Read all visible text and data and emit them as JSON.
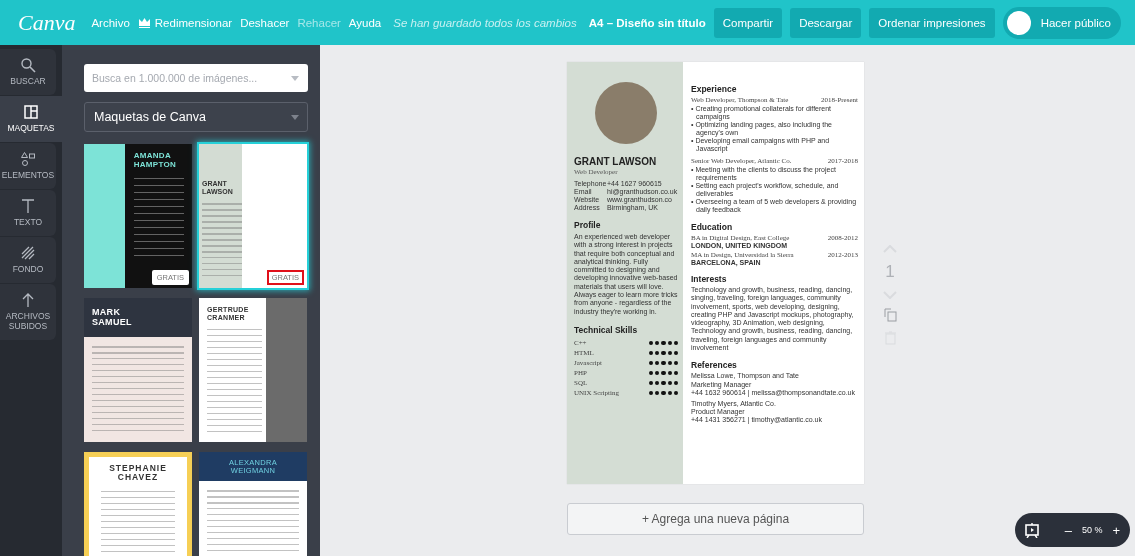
{
  "topbar": {
    "logo": "Canva",
    "menu": [
      {
        "label": "Archivo",
        "disabled": false
      },
      {
        "label": "Redimensionar",
        "disabled": false,
        "kind": "crown"
      },
      {
        "label": "Deshacer",
        "disabled": false
      },
      {
        "label": "Rehacer",
        "disabled": true
      },
      {
        "label": "Ayuda",
        "disabled": false
      }
    ],
    "save_status": "Se han guardado todos los cambios",
    "document_title": "A4 – Diseño sin título",
    "buttons": [
      "Compartir",
      "Descargar",
      "Ordenar impresiones"
    ],
    "public_toggle": {
      "label": "Hacer público",
      "on": false
    }
  },
  "sidebar": {
    "items": [
      {
        "label": "BUSCAR",
        "selected": false
      },
      {
        "label": "MAQUETAS",
        "selected": true
      },
      {
        "label": "ELEMENTOS",
        "selected": false
      },
      {
        "label": "TEXTO",
        "selected": false
      },
      {
        "label": "FONDO",
        "selected": false
      },
      {
        "label": "ARCHIVOS SUBIDOS",
        "selected": false
      }
    ]
  },
  "panel": {
    "search": {
      "placeholder": "Busca en 1.000.000 de imágenes..."
    },
    "dropdown": {
      "value": "Maquetas de Canva"
    },
    "templates": [
      {
        "kind": "teal-pattern",
        "title": "AMANDA HAMPTON",
        "badge": {
          "text": "GRATIS",
          "highlighted": false
        },
        "selected": false
      },
      {
        "kind": "photo-sidebar",
        "title": "GRANT LAWSON",
        "badge": {
          "text": "GRATIS",
          "highlighted": true
        },
        "selected": true
      },
      {
        "kind": "dark-header",
        "title": "MARK SAMUEL",
        "selected": false
      },
      {
        "kind": "photo-right",
        "title": "GERTRUDE CRANMER",
        "selected": false
      },
      {
        "kind": "yellow-frame",
        "title": "STEPHANIE CHAVEZ",
        "selected": false
      },
      {
        "kind": "navy-header",
        "title": "ALEXANDRA WEIGMANN",
        "selected": false
      }
    ]
  },
  "document": {
    "left": {
      "name": "GRANT LAWSON",
      "role": "Web Developer",
      "contacts": [
        {
          "label": "Telephone",
          "value": "+44 1627 960615"
        },
        {
          "label": "Email",
          "value": "hi@granthudson.co.uk"
        },
        {
          "label": "Website",
          "value": "www.granthudson.co"
        },
        {
          "label": "Address",
          "value": "Birmingham, UK"
        }
      ],
      "profile_heading": "Profile",
      "profile": "An experienced web developer with a strong interest in projects that require both conceptual and analytical thinking. Fully committed to designing and developing innovative web-based materials that users will love. Always eager to learn more tricks from anyone - regardless of the industry they're working in.",
      "skills_heading": "Technical Skills",
      "skills": [
        {
          "name": "C++",
          "stars": 5
        },
        {
          "name": "HTML",
          "stars": 5
        },
        {
          "name": "Javascript",
          "stars": 5
        },
        {
          "name": "PHP",
          "stars": 5
        },
        {
          "name": "SQL",
          "stars": 5
        },
        {
          "name": "UNIX Scripting",
          "stars": 5
        }
      ]
    },
    "right": {
      "experience_heading": "Experience",
      "jobs": [
        {
          "title": "Web Developer, Thompson & Tate",
          "dates": "2018-Present",
          "bullets": [
            "• Creating promotional collaterals for different campaigns",
            "• Optimizing landing pages, also including the agency's own",
            "• Developing email campaigns with PHP and Javascript"
          ]
        },
        {
          "title": "Senior Web Developer, Atlantic Co.",
          "dates": "2017-2018",
          "bullets": [
            "• Meeting with the clients to discuss the project requirements",
            "• Setting each project's workflow, schedule, and deliverables",
            "• Overseeing a team of 5 web developers & providing daily feedback"
          ]
        }
      ],
      "education_heading": "Education",
      "education": [
        {
          "degree": "BA in Digital Design, East College",
          "dates": "2008-2012",
          "place": "LONDON, UNITED KINGDOM"
        },
        {
          "degree": "MA in Design, Universidad la Sierra",
          "dates": "2012-2013",
          "place": "BARCELONA, SPAIN"
        }
      ],
      "interests_heading": "Interests",
      "interests": "Technology and growth, business, reading, dancing, singing, traveling, foreign languages, community involvement, sports, web developing, designing, creating PHP and Javascript mockups, photography, videography, 3D Animation, web designing, Technology and growth, business, reading, dancing, traveling, foreign languages and community involvement",
      "references_heading": "References",
      "references": [
        [
          "Melissa Lowe, Thompson and Tate",
          "Marketing Manager",
          "+44 1632 960614 | melissa@thompsonandtate.co.uk"
        ],
        [
          "Timothy Myers, Atlantic Co.",
          "Product Manager",
          "+44 1431 356271 | timothy@atlantic.co.uk"
        ]
      ]
    }
  },
  "page_number": "1",
  "add_page": "+ Agrega una nueva página",
  "zoom": {
    "out": "–",
    "value": "50 %",
    "in": "+"
  }
}
